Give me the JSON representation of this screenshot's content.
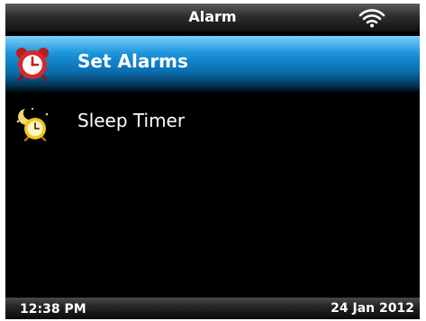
{
  "header": {
    "title": "Alarm",
    "wifi_icon": "wifi-icon"
  },
  "menu": {
    "items": [
      {
        "label": "Set Alarms",
        "icon": "alarm-clock-icon",
        "selected": true
      },
      {
        "label": "Sleep Timer",
        "icon": "moon-clock-icon",
        "selected": false
      }
    ]
  },
  "status": {
    "time": "12:38 PM",
    "date": "24 Jan 2012"
  },
  "colors": {
    "selection_blue": "#1b94dd",
    "screen_background": "#000000",
    "alarm_red": "#d42a2a",
    "sleep_yellow": "#f5c518"
  }
}
